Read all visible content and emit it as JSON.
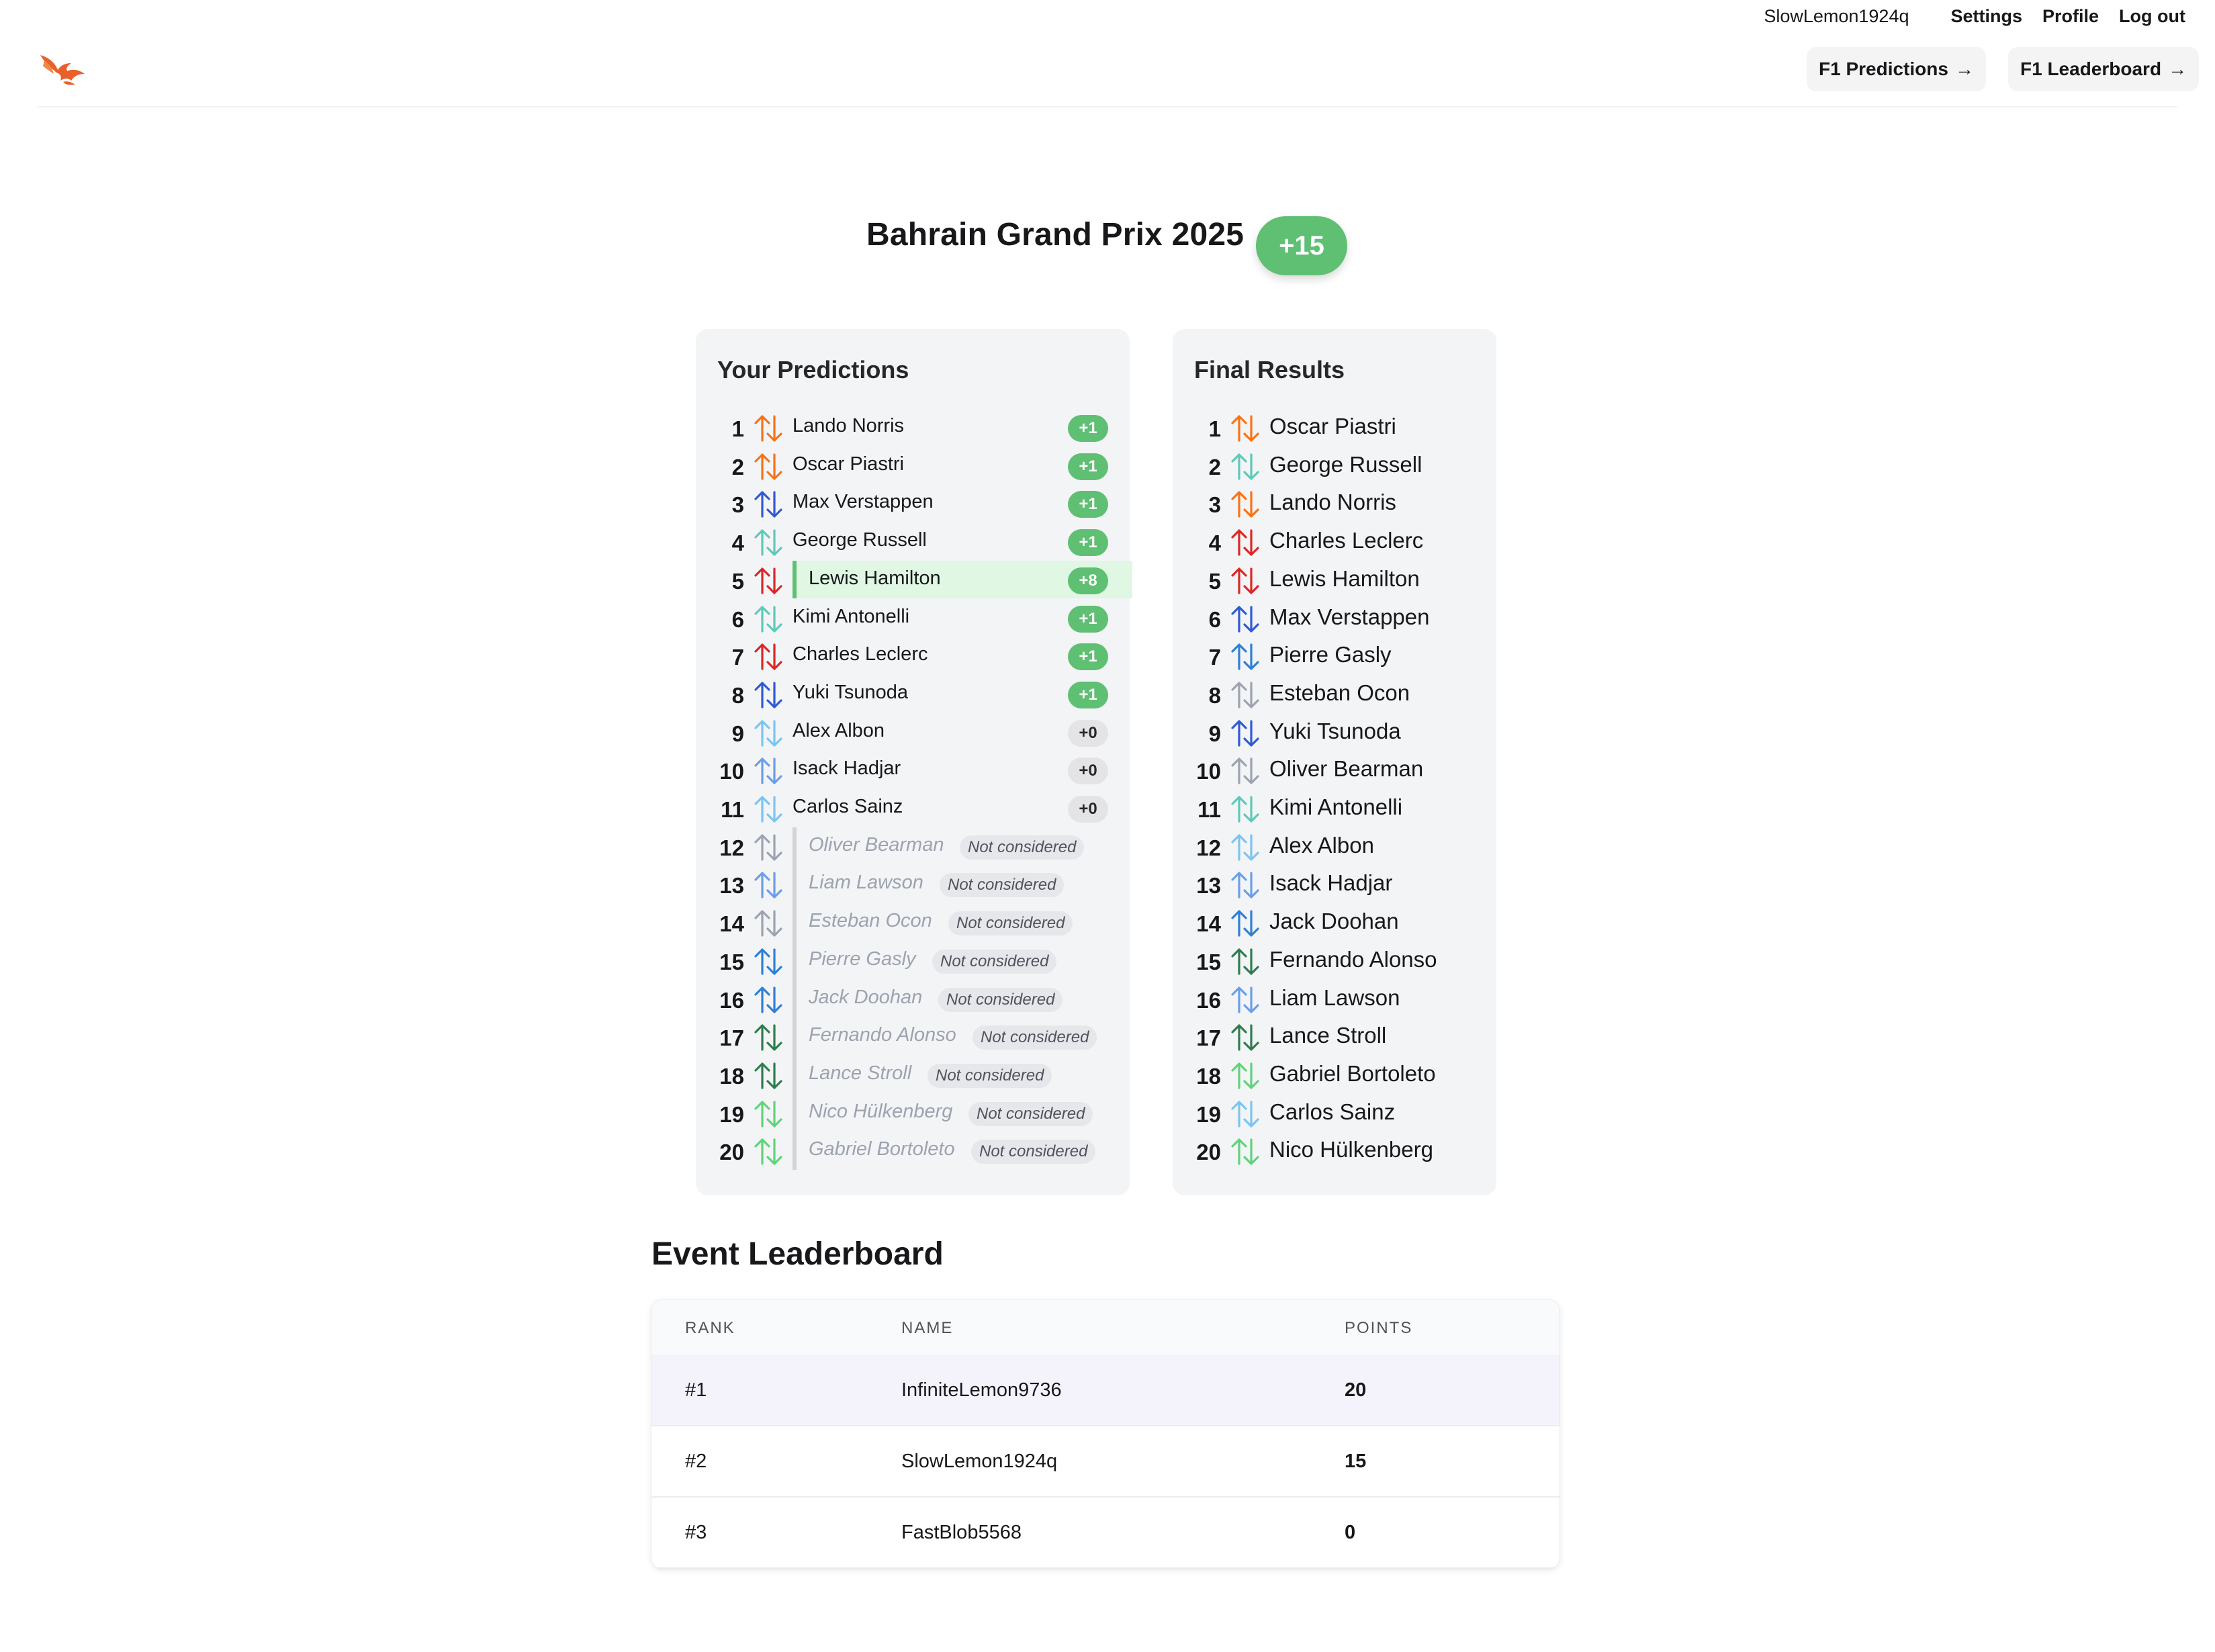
{
  "header": {
    "username": "SlowLemon1924q",
    "links": [
      "Settings",
      "Profile",
      "Log out"
    ],
    "nav_buttons": [
      {
        "label": "F1 Predictions",
        "icon": "arrow-right-icon"
      },
      {
        "label": "F1 Leaderboard",
        "icon": "arrow-right-icon"
      }
    ],
    "logo_icon": "phoenix-logo-icon",
    "arrow_glyph": "→"
  },
  "event": {
    "title": "Bahrain Grand Prix 2025",
    "score": "+15"
  },
  "predictions": {
    "heading": "Your Predictions",
    "rows": [
      {
        "pos": "1",
        "name": "Lando Norris",
        "points": "+1",
        "status": "scored",
        "color": "#f97316"
      },
      {
        "pos": "2",
        "name": "Oscar Piastri",
        "points": "+1",
        "status": "scored",
        "color": "#f97316"
      },
      {
        "pos": "3",
        "name": "Max Verstappen",
        "points": "+1",
        "status": "scored",
        "color": "#2f5ad6"
      },
      {
        "pos": "4",
        "name": "George Russell",
        "points": "+1",
        "status": "scored",
        "color": "#5ec9b8"
      },
      {
        "pos": "5",
        "name": "Lewis Hamilton",
        "points": "+8",
        "status": "highlight",
        "color": "#dc2626"
      },
      {
        "pos": "6",
        "name": "Kimi Antonelli",
        "points": "+1",
        "status": "scored",
        "color": "#5ec9b8"
      },
      {
        "pos": "7",
        "name": "Charles Leclerc",
        "points": "+1",
        "status": "scored",
        "color": "#dc2626"
      },
      {
        "pos": "8",
        "name": "Yuki Tsunoda",
        "points": "+1",
        "status": "scored",
        "color": "#2f5ad6"
      },
      {
        "pos": "9",
        "name": "Alex Albon",
        "points": "+0",
        "status": "zero",
        "color": "#7cc4f0"
      },
      {
        "pos": "10",
        "name": "Isack Hadjar",
        "points": "+0",
        "status": "zero",
        "color": "#6b9ee8"
      },
      {
        "pos": "11",
        "name": "Carlos Sainz",
        "points": "+0",
        "status": "zero",
        "color": "#7cc4f0"
      },
      {
        "pos": "12",
        "name": "Oliver Bearman",
        "points": "Not considered",
        "status": "nc",
        "color": "#9ca3af"
      },
      {
        "pos": "13",
        "name": "Liam Lawson",
        "points": "Not considered",
        "status": "nc",
        "color": "#6b9ee8"
      },
      {
        "pos": "14",
        "name": "Esteban Ocon",
        "points": "Not considered",
        "status": "nc",
        "color": "#9ca3af"
      },
      {
        "pos": "15",
        "name": "Pierre Gasly",
        "points": "Not considered",
        "status": "nc",
        "color": "#2f7fd6"
      },
      {
        "pos": "16",
        "name": "Jack Doohan",
        "points": "Not considered",
        "status": "nc",
        "color": "#2f7fd6"
      },
      {
        "pos": "17",
        "name": "Fernando Alonso",
        "points": "Not considered",
        "status": "nc",
        "color": "#2e7d4f"
      },
      {
        "pos": "18",
        "name": "Lance Stroll",
        "points": "Not considered",
        "status": "nc",
        "color": "#2e7d4f"
      },
      {
        "pos": "19",
        "name": "Nico Hülkenberg",
        "points": "Not considered",
        "status": "nc",
        "color": "#5fd37a"
      },
      {
        "pos": "20",
        "name": "Gabriel Bortoleto",
        "points": "Not considered",
        "status": "nc",
        "color": "#5fd37a"
      }
    ]
  },
  "results": {
    "heading": "Final Results",
    "rows": [
      {
        "pos": "1",
        "name": "Oscar Piastri",
        "color": "#f97316"
      },
      {
        "pos": "2",
        "name": "George Russell",
        "color": "#5ec9b8"
      },
      {
        "pos": "3",
        "name": "Lando Norris",
        "color": "#f97316"
      },
      {
        "pos": "4",
        "name": "Charles Leclerc",
        "color": "#dc2626"
      },
      {
        "pos": "5",
        "name": "Lewis Hamilton",
        "color": "#dc2626"
      },
      {
        "pos": "6",
        "name": "Max Verstappen",
        "color": "#2f5ad6"
      },
      {
        "pos": "7",
        "name": "Pierre Gasly",
        "color": "#2f7fd6"
      },
      {
        "pos": "8",
        "name": "Esteban Ocon",
        "color": "#9ca3af"
      },
      {
        "pos": "9",
        "name": "Yuki Tsunoda",
        "color": "#2f5ad6"
      },
      {
        "pos": "10",
        "name": "Oliver Bearman",
        "color": "#9ca3af"
      },
      {
        "pos": "11",
        "name": "Kimi Antonelli",
        "color": "#5ec9b8"
      },
      {
        "pos": "12",
        "name": "Alex Albon",
        "color": "#7cc4f0"
      },
      {
        "pos": "13",
        "name": "Isack Hadjar",
        "color": "#6b9ee8"
      },
      {
        "pos": "14",
        "name": "Jack Doohan",
        "color": "#2f7fd6"
      },
      {
        "pos": "15",
        "name": "Fernando Alonso",
        "color": "#2e7d4f"
      },
      {
        "pos": "16",
        "name": "Liam Lawson",
        "color": "#6b9ee8"
      },
      {
        "pos": "17",
        "name": "Lance Stroll",
        "color": "#2e7d4f"
      },
      {
        "pos": "18",
        "name": "Gabriel Bortoleto",
        "color": "#5fd37a"
      },
      {
        "pos": "19",
        "name": "Carlos Sainz",
        "color": "#7cc4f0"
      },
      {
        "pos": "20",
        "name": "Nico Hülkenberg",
        "color": "#5fd37a"
      }
    ]
  },
  "leaderboard": {
    "title": "Event Leaderboard",
    "columns": [
      "RANK",
      "NAME",
      "POINTS"
    ],
    "rows": [
      {
        "rank": "#1",
        "name": "InfiniteLemon9736",
        "points": "20",
        "highlight": true
      },
      {
        "rank": "#2",
        "name": "SlowLemon1924q",
        "points": "15",
        "highlight": false
      },
      {
        "rank": "#3",
        "name": "FastBlob5568",
        "points": "0",
        "highlight": false
      }
    ]
  },
  "colors": {
    "accent_green": "#5fbf73",
    "card_bg": "#f3f4f6",
    "highlight_bg": "#dff7e3"
  }
}
